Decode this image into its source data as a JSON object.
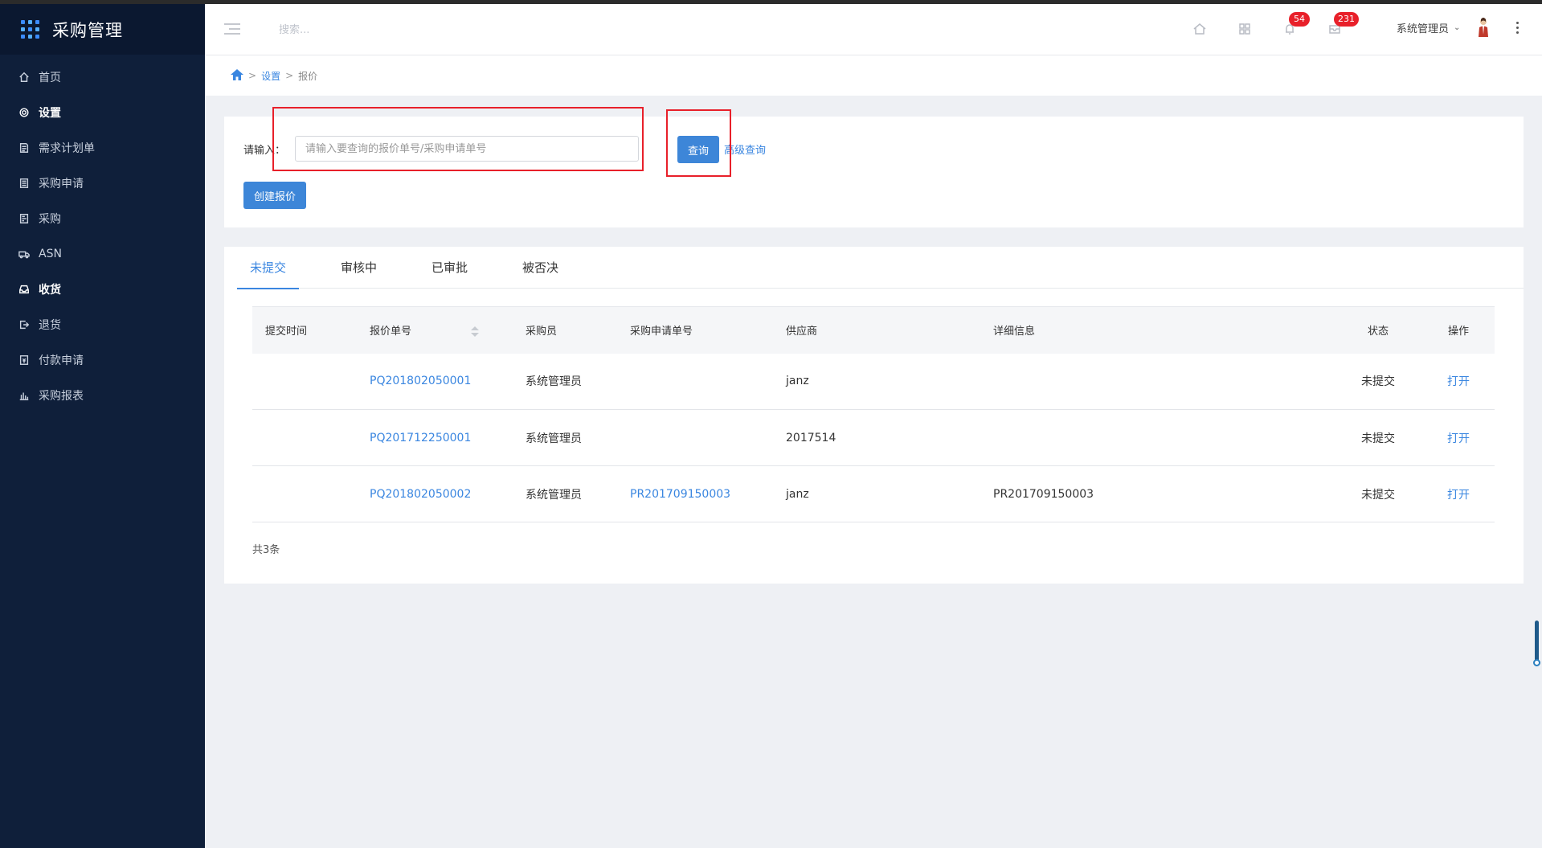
{
  "app": {
    "title": "采购管理"
  },
  "sidebar": {
    "items": [
      {
        "label": "首页",
        "icon": "home-icon",
        "active": false
      },
      {
        "label": "设置",
        "icon": "gear-icon",
        "active": true
      },
      {
        "label": "需求计划单",
        "icon": "document-icon",
        "active": false
      },
      {
        "label": "采购申请",
        "icon": "clipboard-icon",
        "active": false
      },
      {
        "label": "采购",
        "icon": "receipt-icon",
        "active": false
      },
      {
        "label": "ASN",
        "icon": "truck-icon",
        "active": false
      },
      {
        "label": "收货",
        "icon": "inbox-icon",
        "active": true
      },
      {
        "label": "退货",
        "icon": "return-icon",
        "active": false
      },
      {
        "label": "付款申请",
        "icon": "payment-icon",
        "active": false
      },
      {
        "label": "采购报表",
        "icon": "bar-chart-icon",
        "active": false
      }
    ]
  },
  "header": {
    "search_placeholder": "搜索...",
    "notifications_count": "54",
    "messages_count": "231",
    "user_name": "系统管理员"
  },
  "breadcrumb": {
    "items": [
      "设置",
      "报价"
    ]
  },
  "query": {
    "label": "请输入：",
    "placeholder": "请输入要查询的报价单号/采购申请单号",
    "value": "",
    "query_button": "查询",
    "advanced_link": "高级查询",
    "create_button": "创建报价"
  },
  "tabs": [
    {
      "label": "未提交",
      "active": true
    },
    {
      "label": "审核中",
      "active": false
    },
    {
      "label": "已审批",
      "active": false
    },
    {
      "label": "被否决",
      "active": false
    }
  ],
  "table": {
    "columns": [
      "提交时间",
      "报价单号",
      "采购员",
      "采购申请单号",
      "供应商",
      "详细信息",
      "状态",
      "操作"
    ],
    "rows": [
      {
        "submit_time": "",
        "quote_no": "PQ201802050001",
        "buyer": "系统管理员",
        "request_no": "",
        "supplier": "janz",
        "detail": "",
        "status": "未提交",
        "action": "打开"
      },
      {
        "submit_time": "",
        "quote_no": "PQ201712250001",
        "buyer": "系统管理员",
        "request_no": "",
        "supplier": "2017514",
        "detail": "",
        "status": "未提交",
        "action": "打开"
      },
      {
        "submit_time": "",
        "quote_no": "PQ201802050002",
        "buyer": "系统管理员",
        "request_no": "PR201709150003",
        "supplier": "janz",
        "detail": "PR201709150003",
        "status": "未提交",
        "action": "打开"
      }
    ]
  },
  "pagination": {
    "total_text": "共3条"
  }
}
